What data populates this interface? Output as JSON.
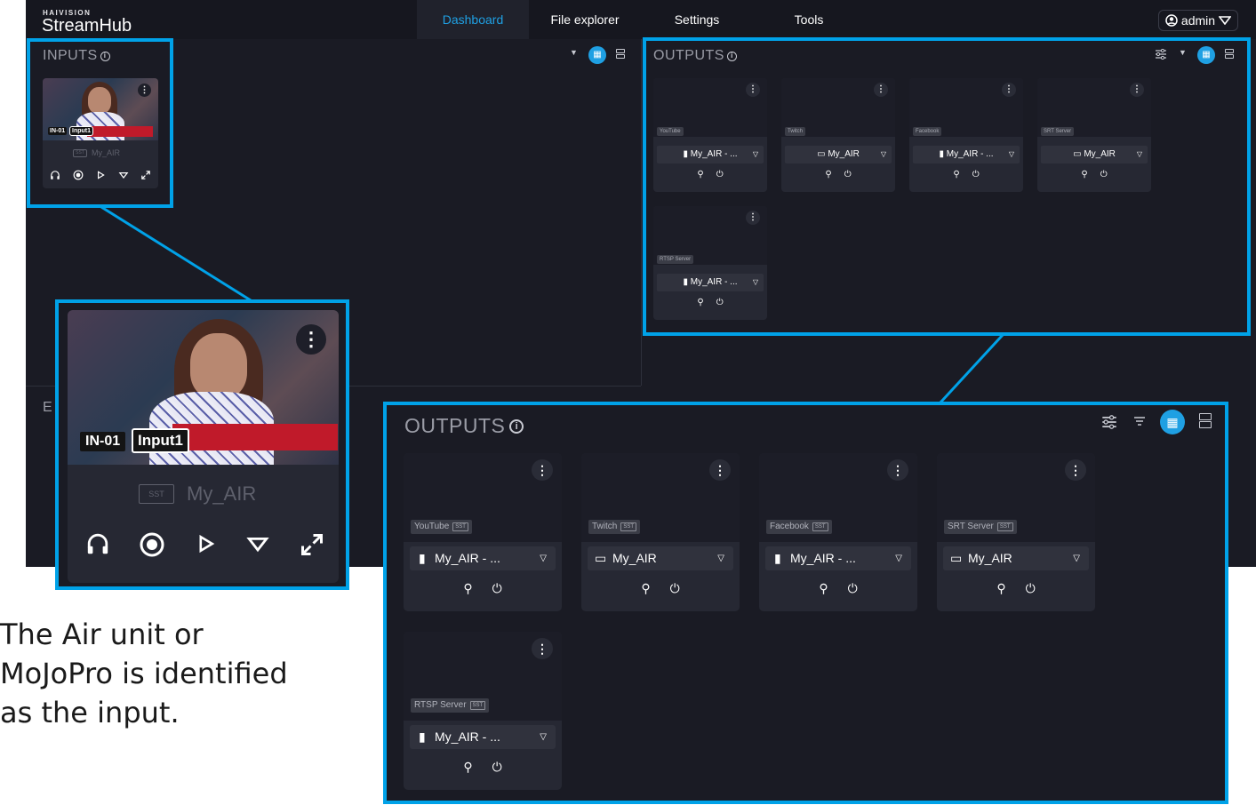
{
  "app": {
    "brand_small": "HAIVISION",
    "brand_big": "StreamHub",
    "nav": [
      "Dashboard",
      "File explorer",
      "Settings",
      "Tools"
    ],
    "active_tab": "Dashboard",
    "user_label": "admin"
  },
  "inputs": {
    "title": "INPUTS",
    "cards": [
      {
        "overlay_id": "IN-01",
        "overlay_name": "Input1",
        "source_badge": "SST",
        "source_name": "My_AIR",
        "controls": [
          "headphones-icon",
          "record-icon",
          "play-icon",
          "dropdown-icon",
          "expand-icon"
        ]
      }
    ]
  },
  "outputs": {
    "title": "OUTPUTS",
    "cards": [
      {
        "platform": "YouTube",
        "source": "My_AIR - ...",
        "source_icon": "file-icon"
      },
      {
        "platform": "Twitch",
        "source": "My_AIR",
        "source_icon": "sst-camera-icon"
      },
      {
        "platform": "Facebook",
        "source": "My_AIR - ...",
        "source_icon": "file-icon"
      },
      {
        "platform": "SRT Server",
        "source": "My_AIR",
        "source_icon": "sst-camera-icon"
      },
      {
        "platform": "RTSP Server",
        "source": "My_AIR - ...",
        "source_icon": "file-icon"
      }
    ]
  },
  "hidden_section_initial": "E",
  "caption": "The Air unit or MoJoPro is identified as the input.",
  "colors": {
    "accent": "#1fa0e3",
    "callout": "#00a2e8",
    "background": "#1a1b24"
  }
}
